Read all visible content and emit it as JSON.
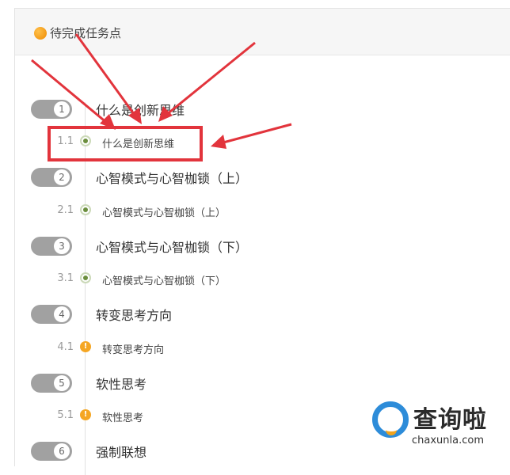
{
  "header": {
    "title": "待完成任务点"
  },
  "colors": {
    "done": "#6b8e3d",
    "pending": "#f5a623",
    "highlight": "#e2343c",
    "pill": "#a1a1a1"
  },
  "chapters": [
    {
      "num": "1",
      "title": "什么是创新思维",
      "sub_num": "1.1",
      "sub_title": "什么是创新思维",
      "status": "done"
    },
    {
      "num": "2",
      "title": "心智模式与心智枷锁（上）",
      "sub_num": "2.1",
      "sub_title": "心智模式与心智枷锁（上）",
      "status": "done"
    },
    {
      "num": "3",
      "title": "心智模式与心智枷锁（下）",
      "sub_num": "3.1",
      "sub_title": "心智模式与心智枷锁（下）",
      "status": "done"
    },
    {
      "num": "4",
      "title": "转变思考方向",
      "sub_num": "4.1",
      "sub_title": "转变思考方向",
      "status": "pending",
      "status_glyph": "!"
    },
    {
      "num": "5",
      "title": "软性思考",
      "sub_num": "5.1",
      "sub_title": "软性思考",
      "status": "pending",
      "status_glyph": "!"
    },
    {
      "num": "6",
      "title": "强制联想"
    }
  ],
  "watermark": {
    "brand": "查询啦",
    "domain": "chaxunla.com"
  }
}
